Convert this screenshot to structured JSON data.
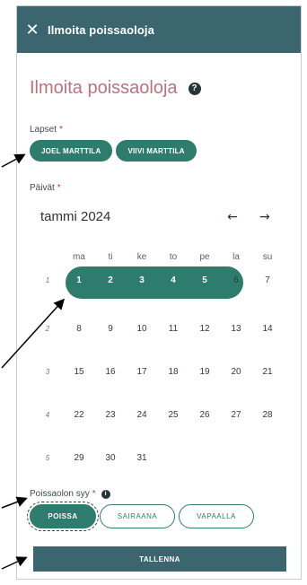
{
  "header": {
    "close_icon": "close-icon",
    "title": "Ilmoita poissaoloja"
  },
  "main": {
    "heading": "Ilmoita poissaoloja",
    "help_icon": "help-icon",
    "help_glyph": "?",
    "children_label": "Lapset",
    "required_mark": "*",
    "children": [
      "JOEL MARTTILA",
      "VIIVI MARTTILA"
    ],
    "days_label": "Päivät"
  },
  "calendar": {
    "month": "tammi 2024",
    "prev_glyph": "←",
    "next_glyph": "→",
    "weekdays": [
      "ma",
      "ti",
      "ke",
      "to",
      "pe",
      "la",
      "su"
    ],
    "weeks": [
      {
        "num": "1",
        "days": [
          "1",
          "2",
          "3",
          "4",
          "5",
          "6",
          "7"
        ]
      },
      {
        "num": "2",
        "days": [
          "8",
          "9",
          "10",
          "11",
          "12",
          "13",
          "14"
        ]
      },
      {
        "num": "3",
        "days": [
          "15",
          "16",
          "17",
          "18",
          "19",
          "20",
          "21"
        ]
      },
      {
        "num": "4",
        "days": [
          "22",
          "23",
          "24",
          "25",
          "26",
          "27",
          "28"
        ]
      },
      {
        "num": "5",
        "days": [
          "29",
          "30",
          "31"
        ]
      }
    ],
    "selected_days": [
      "1",
      "2",
      "3",
      "4",
      "5"
    ]
  },
  "reason": {
    "label": "Poissaolon syy",
    "info_glyph": "i",
    "options": [
      "POISSA",
      "SAIRAANA",
      "VAPAALLA"
    ],
    "selected": "POISSA"
  },
  "save_label": "TALLENNA",
  "colors": {
    "header": "#3b6670",
    "accent": "#2e7c6d",
    "heading": "#b8747e",
    "required": "#c23e4d"
  }
}
